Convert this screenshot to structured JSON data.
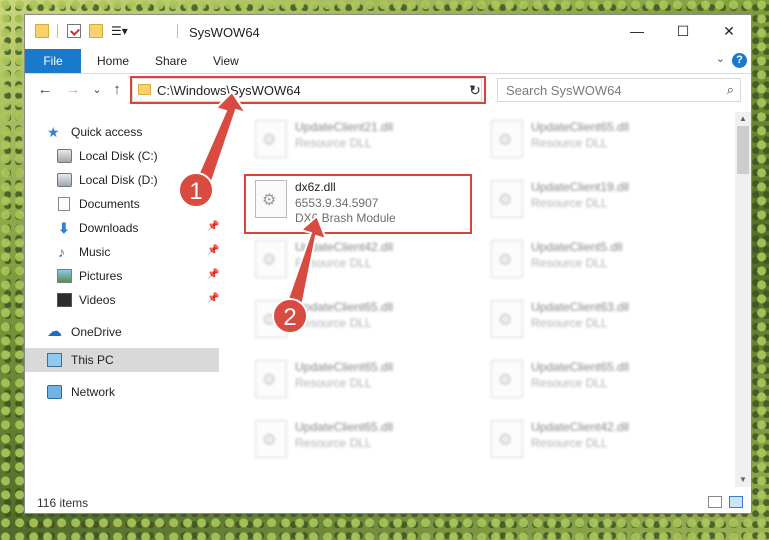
{
  "window": {
    "title": "SysWOW64",
    "controls": {
      "minimize": "—",
      "maximize": "☐",
      "close": "✕"
    }
  },
  "ribbon": {
    "tabs": [
      "File",
      "Home",
      "Share",
      "View"
    ],
    "help": "?"
  },
  "nav": {
    "back": "←",
    "forward": "→",
    "recent": "⌄",
    "up": "↑",
    "refresh": "↻"
  },
  "address": {
    "path": "C:\\Windows\\SysWOW64"
  },
  "search": {
    "placeholder": "Search SysWOW64",
    "icon": "search-icon"
  },
  "sidebar": {
    "items": [
      {
        "label": "Quick access",
        "icon": "star-icon"
      },
      {
        "label": "Local Disk (C:)",
        "icon": "disk-icon"
      },
      {
        "label": "Local Disk (D:)",
        "icon": "disk-icon"
      },
      {
        "label": "Documents",
        "icon": "documents-icon"
      },
      {
        "label": "Downloads",
        "icon": "download-icon"
      },
      {
        "label": "Music",
        "icon": "music-icon"
      },
      {
        "label": "Pictures",
        "icon": "pictures-icon"
      },
      {
        "label": "Videos",
        "icon": "videos-icon"
      },
      {
        "label": "OneDrive",
        "icon": "cloud-icon"
      },
      {
        "label": "This PC",
        "icon": "pc-icon"
      },
      {
        "label": "Network",
        "icon": "network-icon"
      }
    ]
  },
  "files": {
    "highlighted": {
      "name": "dx6z.dll",
      "version": "6553.9.34.5907",
      "description": "DX6 Brash Module"
    },
    "left_column": [
      {
        "name": "UpdateClient21.dll",
        "type": "Resource DLL"
      },
      {
        "name": "UpdateClient42.dll",
        "type": "Resource DLL"
      },
      {
        "name": "UpdateClient65.dll",
        "type": "Resource DLL"
      },
      {
        "name": "UpdateClient65.dll",
        "type": "Resource DLL"
      },
      {
        "name": "UpdateClient65.dll",
        "type": "Resource DLL"
      }
    ],
    "right_column": [
      {
        "name": "UpdateClient65.dll",
        "type": "Resource DLL"
      },
      {
        "name": "UpdateClient19.dll",
        "type": "Resource DLL"
      },
      {
        "name": "UpdateClient5.dll",
        "type": "Resource DLL"
      },
      {
        "name": "UpdateClient63.dll",
        "type": "Resource DLL"
      },
      {
        "name": "UpdateClient65.dll",
        "type": "Resource DLL"
      },
      {
        "name": "UpdateClient42.dll",
        "type": "Resource DLL"
      }
    ]
  },
  "status": {
    "item_count": "116 items"
  },
  "callouts": [
    "1",
    "2"
  ],
  "colors": {
    "accent": "#1979ca",
    "highlight": "#d9433a",
    "selected_nav": "#d9d9d9"
  }
}
